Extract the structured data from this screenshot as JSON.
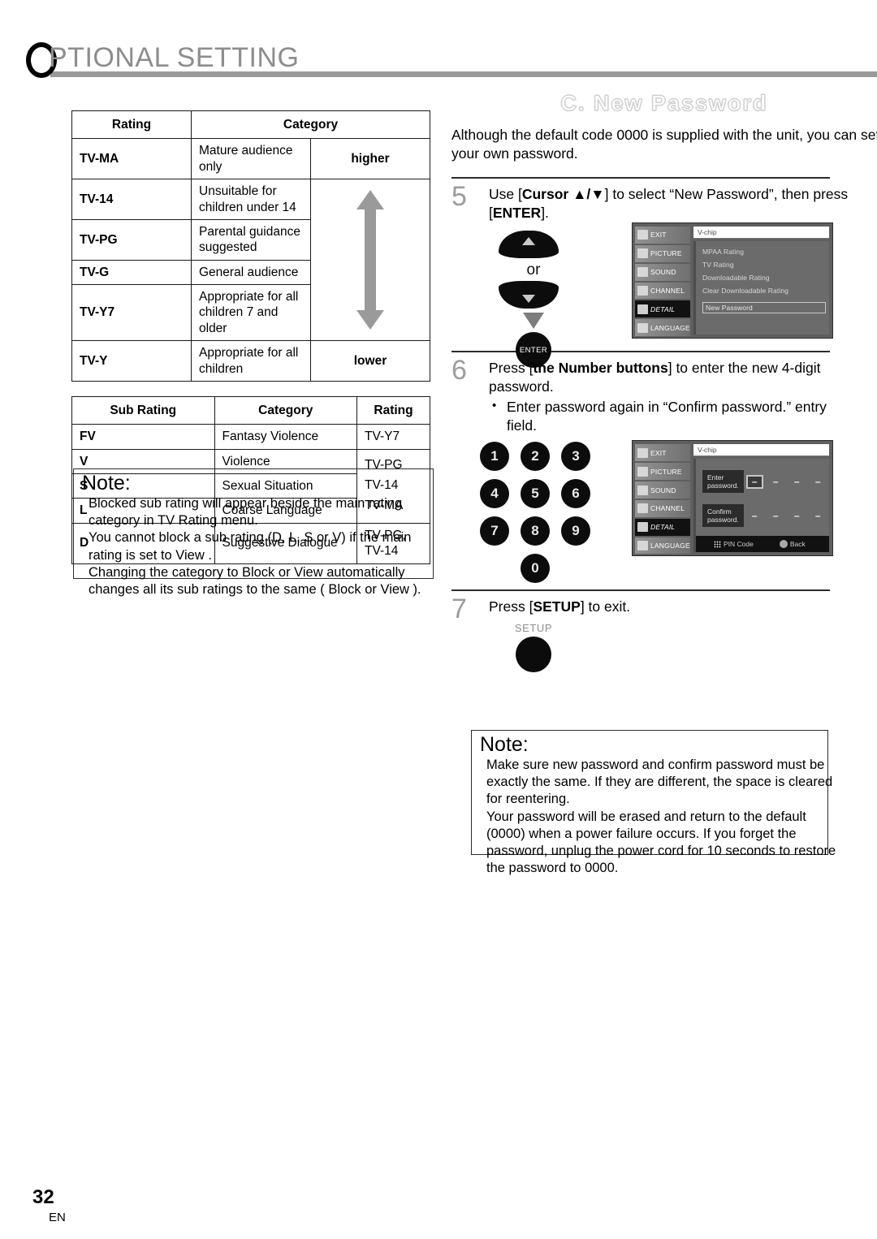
{
  "header": {
    "title": "PTIONAL SETTING",
    "drop_cap": "O"
  },
  "rating_table": {
    "columns": [
      "Rating",
      "Category",
      ""
    ],
    "scale_high": "higher",
    "scale_low": "lower",
    "rows": [
      {
        "code": "TV-MA",
        "category": "Mature audience only"
      },
      {
        "code": "TV-14",
        "category": "Unsuitable for children under 14"
      },
      {
        "code": "TV-PG",
        "category": "Parental guidance suggested"
      },
      {
        "code": "TV-G",
        "category": "General audience"
      },
      {
        "code": "TV-Y7",
        "category": "Appropriate for all children 7 and older"
      },
      {
        "code": "TV-Y",
        "category": "Appropriate for all children"
      }
    ]
  },
  "sub_rating_table": {
    "columns": [
      "Sub Rating",
      "Category",
      "Rating"
    ],
    "rows": [
      {
        "code": "FV",
        "category": "Fantasy Violence",
        "rating": "TV-Y7"
      },
      {
        "code": "V",
        "category": "Violence",
        "rating": "TV-PG"
      },
      {
        "code": "S",
        "category": "Sexual Situation",
        "rating": "TV-14"
      },
      {
        "code": "L",
        "category": "Coarse Language",
        "rating": "TV-MA"
      },
      {
        "code": "D",
        "category": "Suggestive Dialogue",
        "rating": "TV-PG, TV-14"
      }
    ]
  },
  "note_left": {
    "title": "Note:",
    "lines": [
      "Blocked sub rating will appear beside the main rating",
      "category in  TV Rating  menu.",
      "You cannot block a sub rating (D, L, S or V) if the main",
      "rating is set to  View .",
      "Changing the category to  Block  or  View  automatically",
      "changes all its sub ratings to the same ( Block  or  View )."
    ]
  },
  "section": {
    "title": "C. New Password",
    "intro": "Although the default code  0000  is supplied with the unit, you can set your own password."
  },
  "steps": [
    {
      "number": "5",
      "text_parts": [
        "Use [",
        "Cursor ▲/▼",
        "] to select “New Password”, then press [",
        "ENTER",
        "]."
      ]
    },
    {
      "number": "6",
      "text_parts": [
        "Press [",
        "the Number buttons",
        "] to enter the new 4-digit password."
      ],
      "bullet": "Enter password again in “Confirm password.” entry field."
    },
    {
      "number": "7",
      "text_parts": [
        "Press [",
        "SETUP",
        "] to exit."
      ]
    }
  ],
  "keys": {
    "or_label": "or",
    "enter_label": "ENTER",
    "setup_label": "SETUP",
    "numbers": [
      "1",
      "2",
      "3",
      "4",
      "5",
      "6",
      "7",
      "8",
      "9",
      "0"
    ]
  },
  "osd_menu": {
    "sidebar": [
      {
        "label": "EXIT",
        "icon": "exit-icon",
        "active": false
      },
      {
        "label": "PICTURE",
        "icon": "picture-icon",
        "active": false
      },
      {
        "label": "SOUND",
        "icon": "sound-icon",
        "active": false
      },
      {
        "label": "CHANNEL",
        "icon": "channel-icon",
        "active": false
      },
      {
        "label": "DETAIL",
        "icon": "detail-icon",
        "active": true
      },
      {
        "label": "LANGUAGE",
        "icon": "language-icon",
        "active": false
      }
    ],
    "title": "V-chip",
    "list": [
      "MPAA Rating",
      "TV Rating",
      "Downloadable Rating",
      "Clear Downloadable Rating"
    ],
    "selected": "New Password"
  },
  "osd_password": {
    "title": "V-chip",
    "enter_label": "Enter password.",
    "confirm_label": "Confirm password.",
    "digit_placeholder": "–",
    "footer": [
      {
        "icon": "keypad-icon",
        "label": "PIN Code"
      },
      {
        "icon": "back-button-icon",
        "label": "Back"
      }
    ]
  },
  "note_right": {
    "title": "Note:",
    "lines": [
      "Make sure new password and confirm password must be",
      "exactly the same. If they are different, the space is cleared",
      "for reentering.",
      "Your password will be erased and return to the default",
      "(0000) when a power failure occurs. If you forget the",
      "password, unplug the power cord for 10 seconds to restore",
      "the password to 0000."
    ]
  },
  "footer": {
    "page_number": "32",
    "language_code": "EN"
  }
}
